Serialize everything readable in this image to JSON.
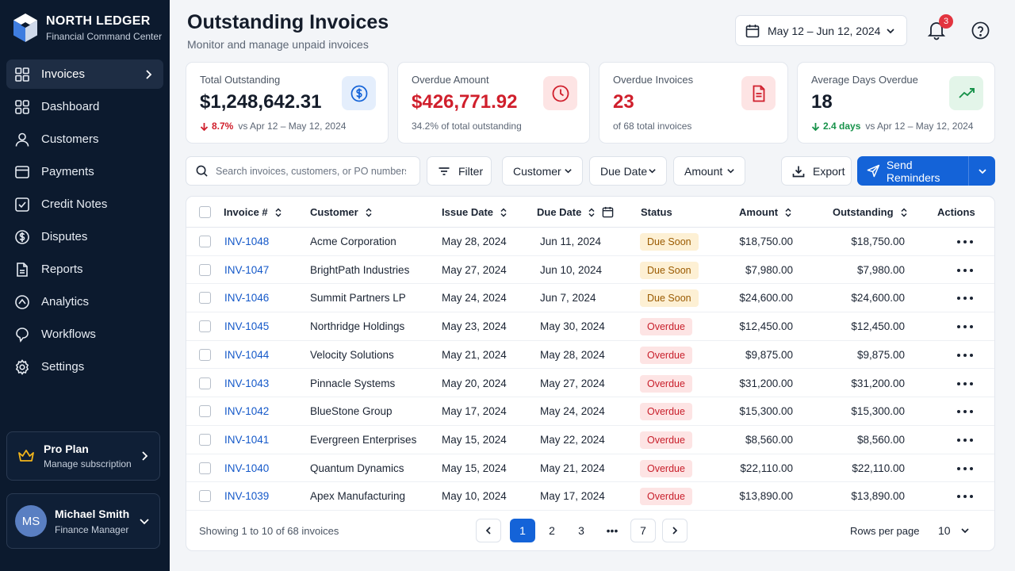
{
  "brand": {
    "name": "NORTH LEDGER",
    "tagline": "Financial Command Center"
  },
  "nav": [
    {
      "label": "Invoices",
      "icon": "grid-icon"
    },
    {
      "label": "Dashboard",
      "icon": "dashboard-icon"
    },
    {
      "label": "Customers",
      "icon": "user-icon"
    },
    {
      "label": "Payments",
      "icon": "wallet-icon"
    },
    {
      "label": "Credit Notes",
      "icon": "check-square-icon"
    },
    {
      "label": "Disputes",
      "icon": "dollar-circle-icon"
    },
    {
      "label": "Reports",
      "icon": "document-icon"
    },
    {
      "label": "Analytics",
      "icon": "compass-icon"
    },
    {
      "label": "Workflows",
      "icon": "flow-icon"
    },
    {
      "label": "Settings",
      "icon": "gear-icon"
    }
  ],
  "plan": {
    "title": "Pro Plan",
    "subtitle": "Manage subscription"
  },
  "user": {
    "initials": "MS",
    "name": "Michael Smith",
    "role": "Finance Manager"
  },
  "header": {
    "title": "Outstanding Invoices",
    "subtitle": "Monitor and manage unpaid invoices",
    "date_range": "May 12 – Jun 12, 2024",
    "notification_count": "3"
  },
  "kpis": {
    "total": {
      "label": "Total Outstanding",
      "value": "$1,248,642.31",
      "delta": "8.7%",
      "compare": "vs Apr 12 – May 12, 2024"
    },
    "overdue_amount": {
      "label": "Overdue Amount",
      "value": "$426,771.92",
      "note": "34.2% of total outstanding"
    },
    "overdue_invoices": {
      "label": "Overdue Invoices",
      "value": "23",
      "note": "of 68 total invoices"
    },
    "avg_days": {
      "label": "Average Days Overdue",
      "value": "18",
      "delta": "2.4 days",
      "compare": "vs Apr 12 – May 12, 2024"
    }
  },
  "toolbar": {
    "search_placeholder": "Search invoices, customers, or PO numbers...",
    "filter": "Filter",
    "customer": "Customer",
    "due_date": "Due Date",
    "amount": "Amount",
    "export": "Export",
    "send": "Send Reminders"
  },
  "table": {
    "columns": {
      "invoice": "Invoice #",
      "customer": "Customer",
      "issue": "Issue Date",
      "due": "Due Date",
      "status": "Status",
      "amount": "Amount",
      "outstanding": "Outstanding",
      "actions": "Actions"
    },
    "rows": [
      {
        "inv": "INV-1048",
        "customer": "Acme Corporation",
        "issue": "May 28, 2024",
        "due": "Jun 11, 2024",
        "status": "Due Soon",
        "amount": "$18,750.00",
        "outstanding": "$18,750.00"
      },
      {
        "inv": "INV-1047",
        "customer": "BrightPath Industries",
        "issue": "May 27, 2024",
        "due": "Jun 10, 2024",
        "status": "Due Soon",
        "amount": "$7,980.00",
        "outstanding": "$7,980.00"
      },
      {
        "inv": "INV-1046",
        "customer": "Summit Partners LP",
        "issue": "May 24, 2024",
        "due": "Jun 7, 2024",
        "status": "Due Soon",
        "amount": "$24,600.00",
        "outstanding": "$24,600.00"
      },
      {
        "inv": "INV-1045",
        "customer": "Northridge Holdings",
        "issue": "May 23, 2024",
        "due": "May 30, 2024",
        "status": "Overdue",
        "amount": "$12,450.00",
        "outstanding": "$12,450.00"
      },
      {
        "inv": "INV-1044",
        "customer": "Velocity Solutions",
        "issue": "May 21, 2024",
        "due": "May 28, 2024",
        "status": "Overdue",
        "amount": "$9,875.00",
        "outstanding": "$9,875.00"
      },
      {
        "inv": "INV-1043",
        "customer": "Pinnacle Systems",
        "issue": "May 20, 2024",
        "due": "May 27, 2024",
        "status": "Overdue",
        "amount": "$31,200.00",
        "outstanding": "$31,200.00"
      },
      {
        "inv": "INV-1042",
        "customer": "BlueStone Group",
        "issue": "May 17, 2024",
        "due": "May 24, 2024",
        "status": "Overdue",
        "amount": "$15,300.00",
        "outstanding": "$15,300.00"
      },
      {
        "inv": "INV-1041",
        "customer": "Evergreen Enterprises",
        "issue": "May 15, 2024",
        "due": "May 22, 2024",
        "status": "Overdue",
        "amount": "$8,560.00",
        "outstanding": "$8,560.00"
      },
      {
        "inv": "INV-1040",
        "customer": "Quantum Dynamics",
        "issue": "May 15, 2024",
        "due": "May 21, 2024",
        "status": "Overdue",
        "amount": "$22,110.00",
        "outstanding": "$22,110.00"
      },
      {
        "inv": "INV-1039",
        "customer": "Apex Manufacturing",
        "issue": "May 10, 2024",
        "due": "May 17, 2024",
        "status": "Overdue",
        "amount": "$13,890.00",
        "outstanding": "$13,890.00"
      }
    ]
  },
  "footer": {
    "showing": "Showing 1 to 10 of 68 invoices",
    "pages": [
      "1",
      "2",
      "3",
      "•••",
      "7"
    ],
    "rows_per_page_label": "Rows per page",
    "rows_per_page": "10"
  },
  "colors": {
    "sidebar": "#0c1a2e",
    "accent": "#1463d8",
    "overdue": "#d01f2c",
    "positive": "#17924a",
    "due_soon": "#9a5a00"
  }
}
